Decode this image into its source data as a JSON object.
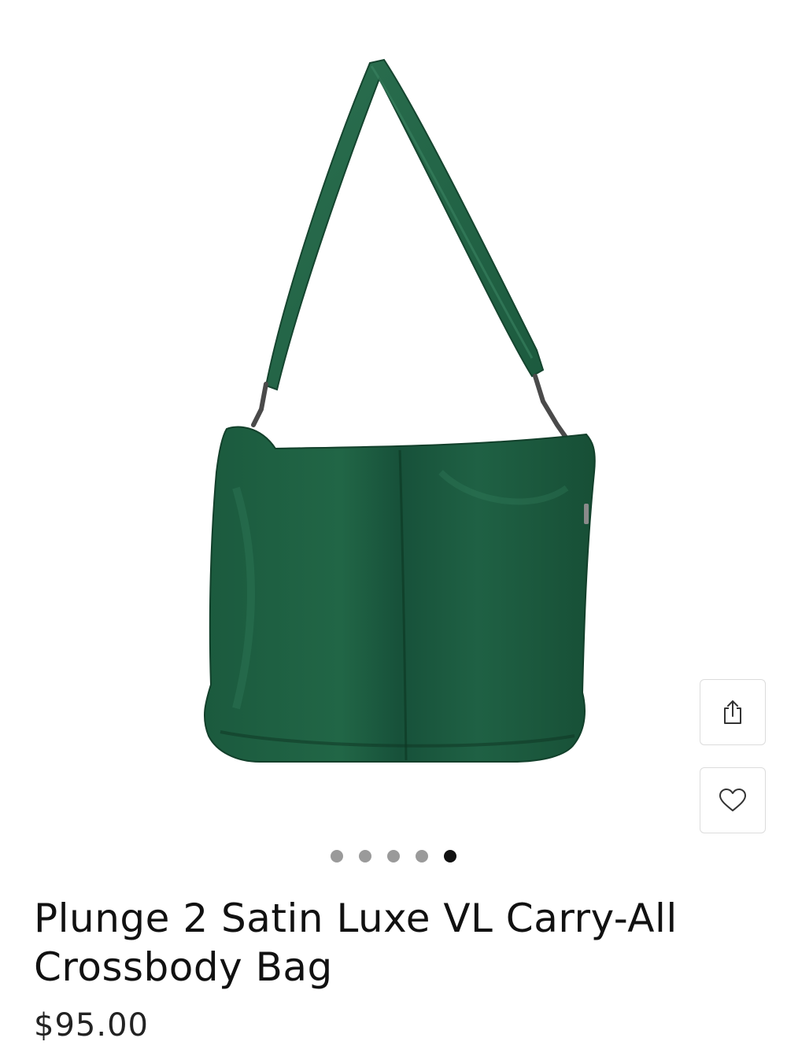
{
  "product": {
    "title": "Plunge 2 Satin Luxe VL Carry-All Crossbody Bag",
    "price": "$95.00",
    "bag_color": "#1f5c41",
    "image_alt": "green satin crossbody bag"
  },
  "gallery": {
    "slides": [
      "slide-1",
      "slide-2",
      "slide-3",
      "slide-4",
      "slide-5"
    ],
    "active_index": 4,
    "dot_color": "#9a9a9a",
    "active_dot_color": "#111111"
  },
  "actions": {
    "share_icon": "share-icon",
    "wishlist_icon": "heart-icon"
  }
}
